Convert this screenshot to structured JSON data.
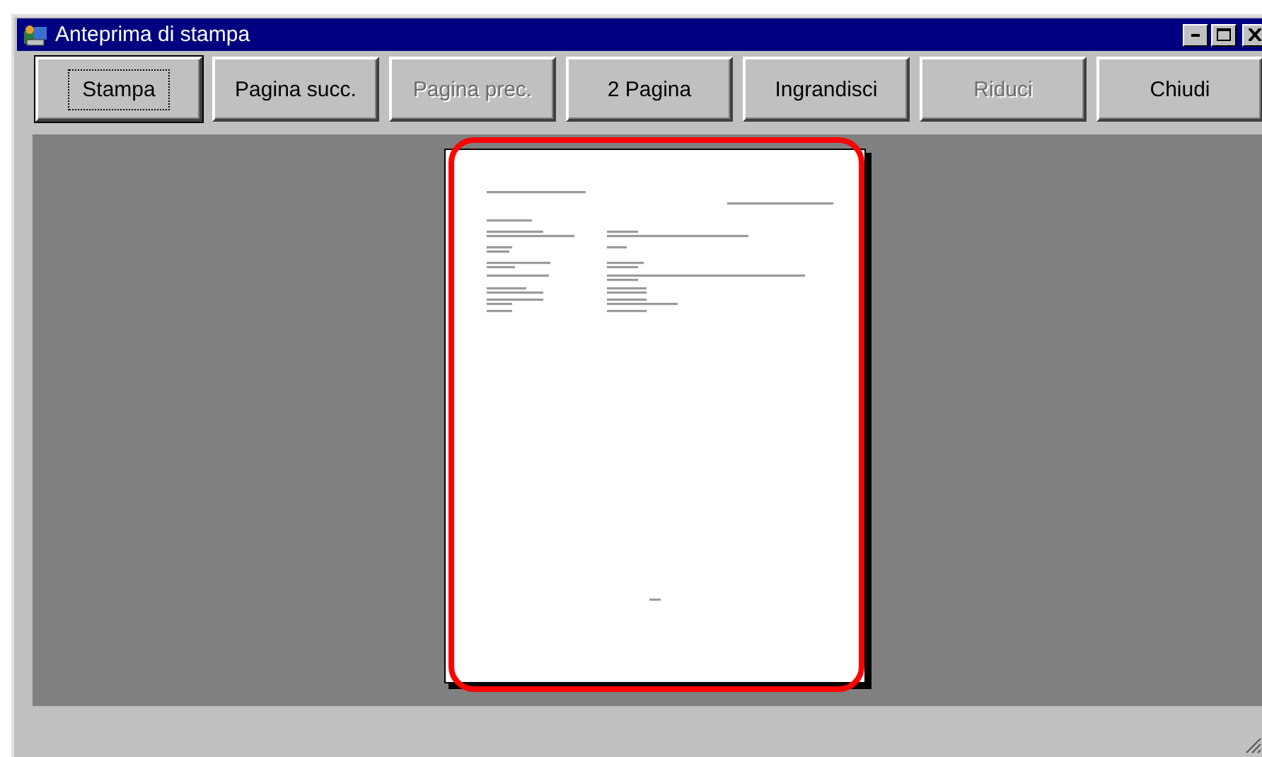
{
  "window": {
    "title": "Anteprima di stampa"
  },
  "toolbar": [
    {
      "label": "Stampa",
      "disabled": false,
      "focused": true
    },
    {
      "label": "Pagina succ.",
      "disabled": false,
      "focused": false
    },
    {
      "label": "Pagina prec.",
      "disabled": true,
      "focused": false
    },
    {
      "label": "2 Pagina",
      "disabled": false,
      "focused": false
    },
    {
      "label": "Ingrandisci",
      "disabled": false,
      "focused": false
    },
    {
      "label": "Riduci",
      "disabled": true,
      "focused": false
    },
    {
      "label": "Chiudi",
      "disabled": false,
      "focused": false
    }
  ]
}
